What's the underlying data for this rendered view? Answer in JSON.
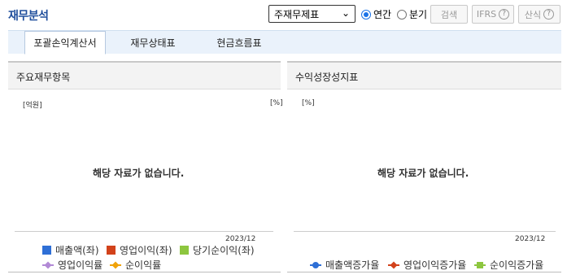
{
  "header": {
    "title": "재무분석",
    "select_value": "주재무제표",
    "radio_annual": "연간",
    "radio_quarter": "분기",
    "search_button": "검색",
    "ifrs_button": "IFRS",
    "formula_button": "산식",
    "help_glyph": "?"
  },
  "tabs": [
    {
      "label": "포괄손익계산서",
      "active": true
    },
    {
      "label": "재무상태표",
      "active": false
    },
    {
      "label": "현금흐름표",
      "active": false
    }
  ],
  "left_panel": {
    "title": "주요재무항목",
    "unit_left": "[억원]",
    "unit_right": "[%]",
    "no_data": "해당 자료가 없습니다.",
    "x_label": "2023/12",
    "legend": [
      {
        "label": "매출액(좌)",
        "color": "#2e6fd6",
        "shape": "square"
      },
      {
        "label": "영업이익(좌)",
        "color": "#d2421b",
        "shape": "square"
      },
      {
        "label": "당기순이익(좌)",
        "color": "#8dc63f",
        "shape": "square"
      },
      {
        "label": "영업이익률",
        "color": "#b28ad6",
        "shape": "diamond"
      },
      {
        "label": "순이익률",
        "color": "#f0a30a",
        "shape": "diamond"
      }
    ]
  },
  "right_panel": {
    "title": "수익성장성지표",
    "unit_left": "[%]",
    "no_data": "해당 자료가 없습니다.",
    "x_label": "2023/12",
    "legend": [
      {
        "label": "매출액증가율",
        "color": "#2e6fd6",
        "shape": "circle"
      },
      {
        "label": "영업이익증가율",
        "color": "#d2421b",
        "shape": "diamond"
      },
      {
        "label": "순이익증가율",
        "color": "#8dc63f",
        "shape": "square"
      }
    ]
  }
}
